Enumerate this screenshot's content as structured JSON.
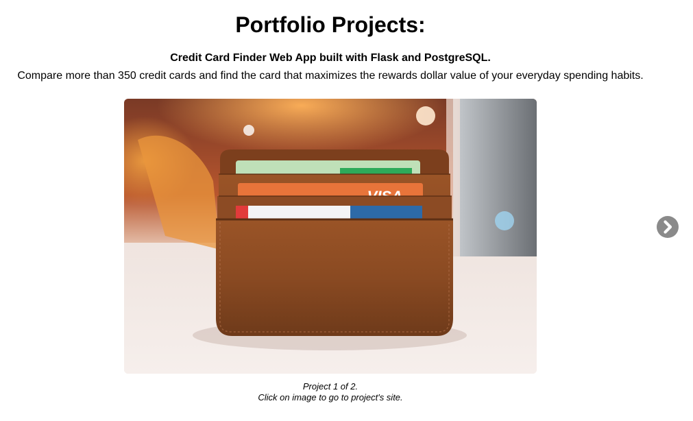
{
  "page": {
    "title": "Portfolio Projects:"
  },
  "project": {
    "name": "Credit Card Finder Web App built with Flask and PostgreSQL.",
    "description": "Compare more than 350 credit cards and find the card that maximizes the rewards dollar value of your everyday spending habits.",
    "image_alt": "Leather wallet holding credit cards",
    "card_text": "VISA",
    "counter": "Project 1 of 2.",
    "hint": "Click on image to go to project's site."
  },
  "controls": {
    "next_icon": "chevron-right-circle-icon"
  },
  "colors": {
    "arrow": "#8a8a8a"
  }
}
